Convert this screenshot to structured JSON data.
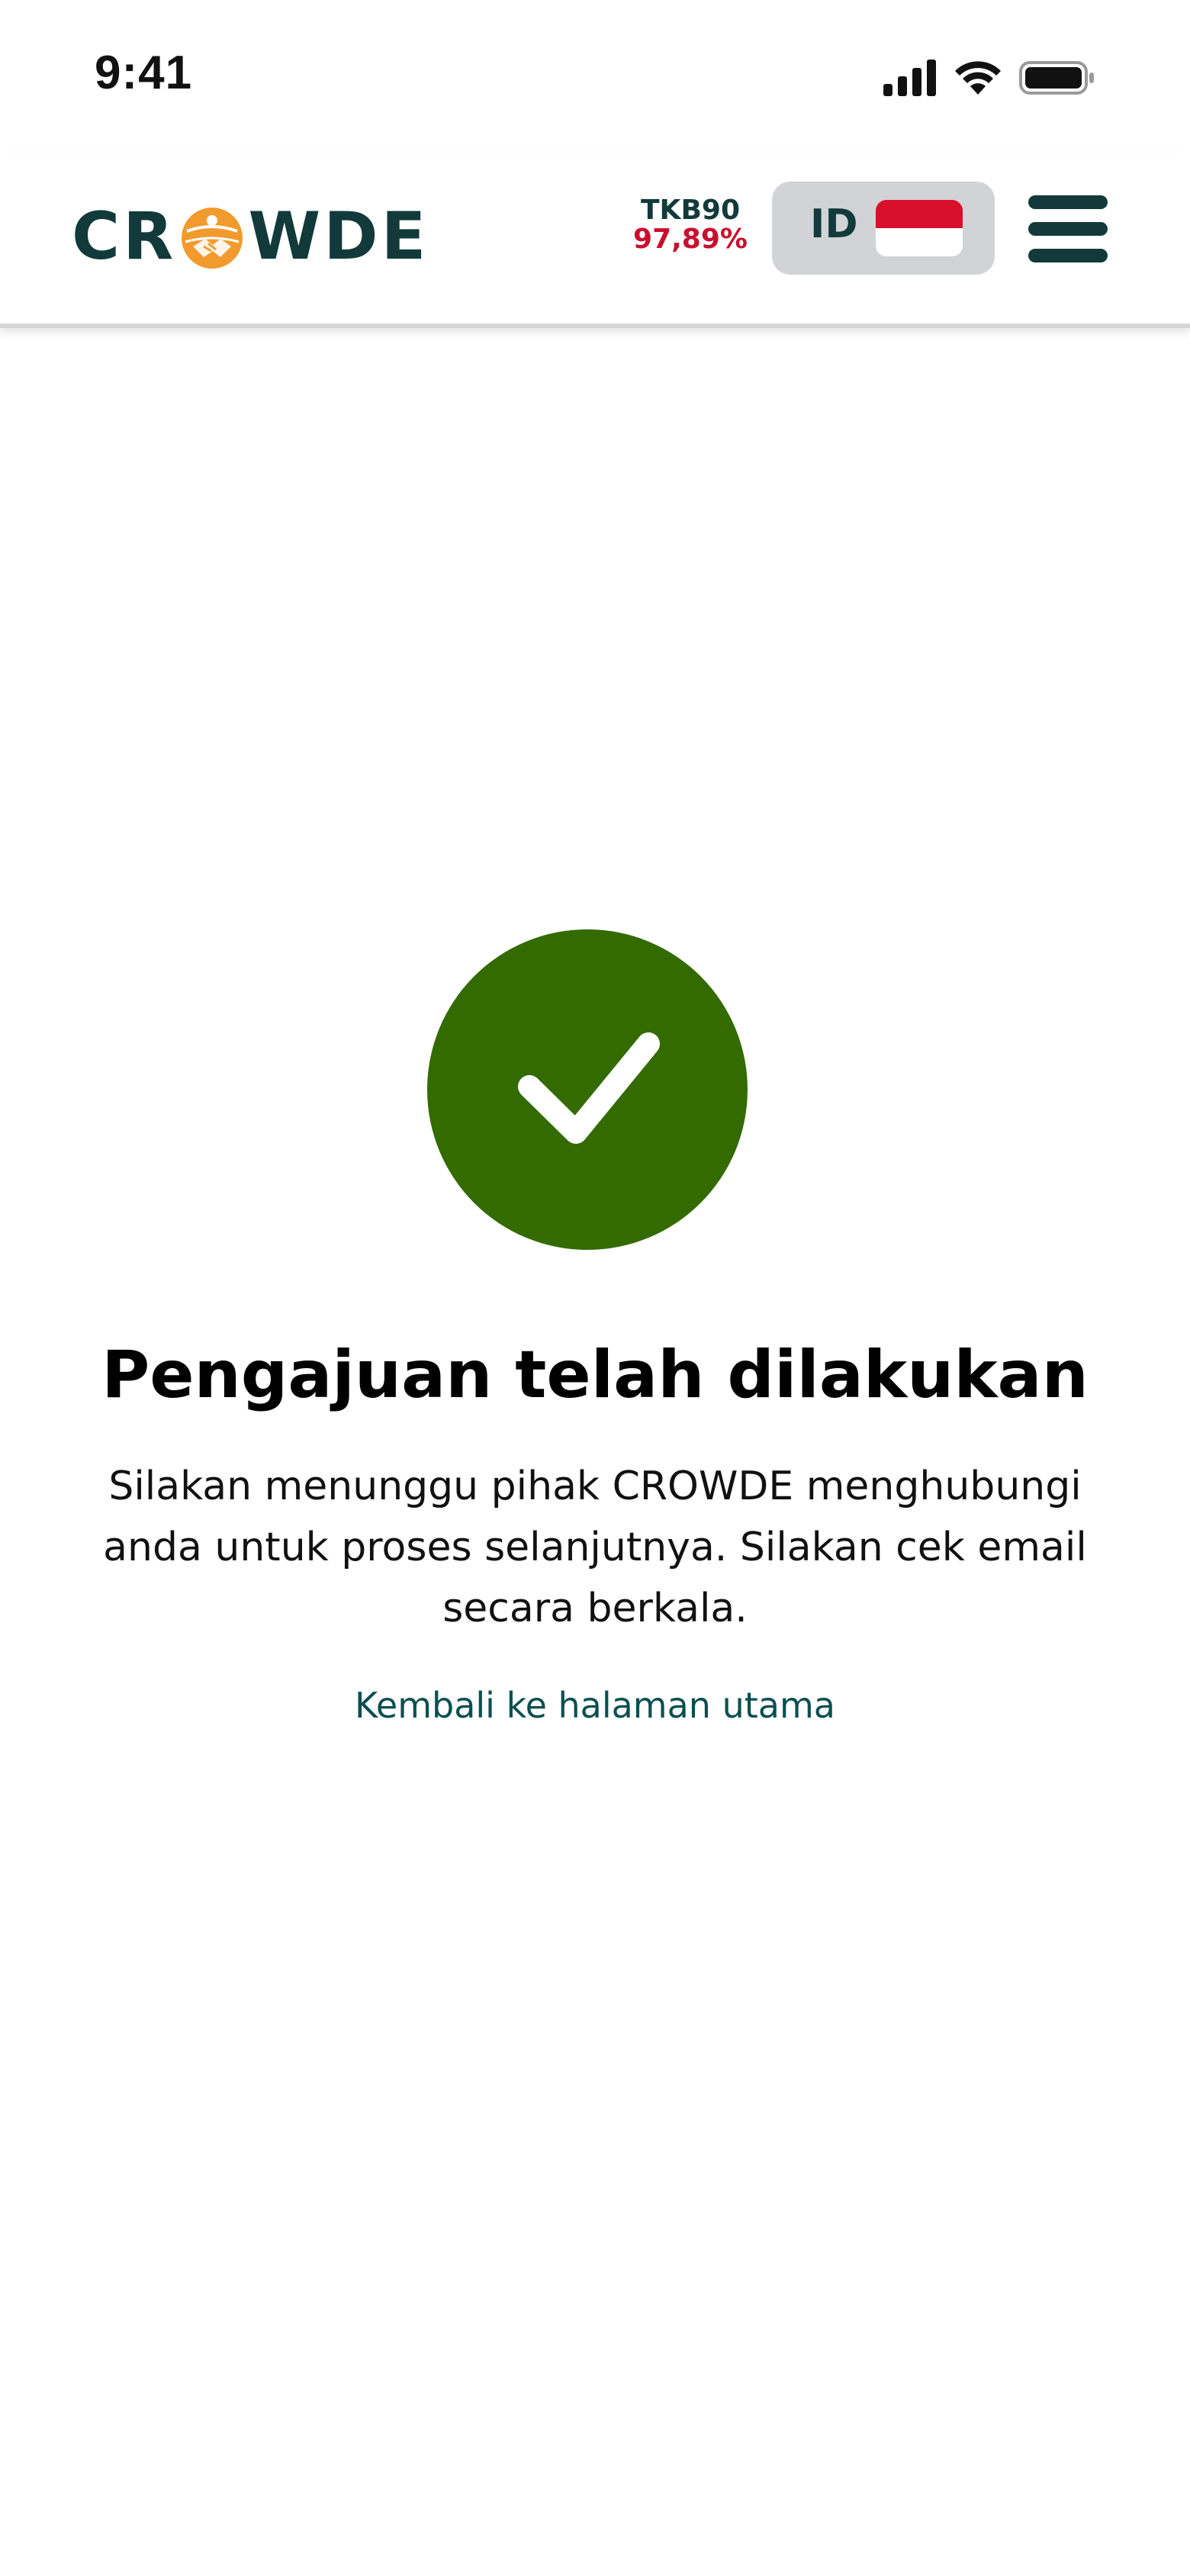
{
  "status_bar": {
    "time": "9:41",
    "icons": [
      "cellular-signal-icon",
      "wifi-icon",
      "battery-icon"
    ]
  },
  "header": {
    "logo_text_before": "CR",
    "logo_text_after": "WDE",
    "logo_icon": "handshake-globe-icon",
    "tkb_label": "TKB90",
    "tkb_value": "97,89%",
    "language_code": "ID",
    "flag": "indonesia-flag-icon",
    "menu_icon": "hamburger-menu-icon"
  },
  "content": {
    "icon": "checkmark-circle-icon",
    "title": "Pengajuan telah dilakukan",
    "message": "Silakan menunggu pihak CROWDE menghubungi anda untuk proses selanjutnya. Silakan cek email secara berkala.",
    "link_label": "Kembali ke halaman utama"
  },
  "colors": {
    "brand_dark": "#123a3a",
    "brand_orange": "#f29a2e",
    "success_green": "#336b00",
    "tkb_red": "#c8102e",
    "link_teal": "#0b4f4f"
  }
}
